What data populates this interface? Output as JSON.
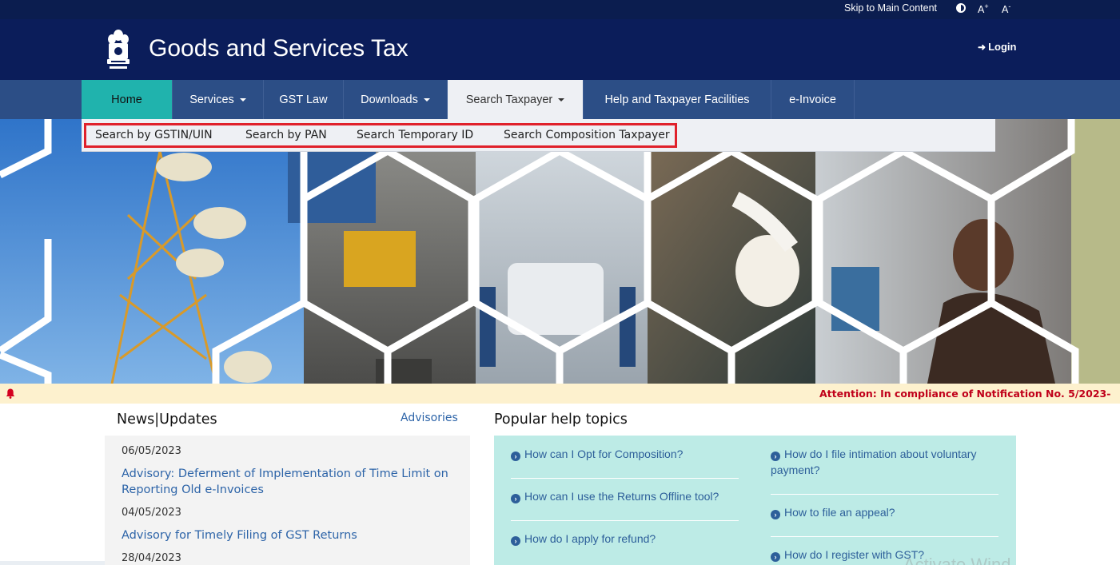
{
  "topbar": {
    "skip_label": "Skip to Main Content",
    "font_increase": "A",
    "font_increase_sup": "+",
    "font_decrease": "A",
    "font_decrease_sup": "-"
  },
  "header": {
    "title": "Goods and Services Tax",
    "login_label": "Login"
  },
  "nav": {
    "tabs": [
      {
        "label": "Home"
      },
      {
        "label": "Services"
      },
      {
        "label": "GST Law"
      },
      {
        "label": "Downloads"
      },
      {
        "label": "Search Taxpayer"
      },
      {
        "label": "Help and Taxpayer Facilities"
      },
      {
        "label": "e-Invoice"
      }
    ],
    "active_tab": "Search Taxpayer"
  },
  "submenu": {
    "items": [
      {
        "label": "Search by GSTIN/UIN"
      },
      {
        "label": "Search by PAN"
      },
      {
        "label": "Search Temporary ID"
      },
      {
        "label": "Search Composition Taxpayer"
      }
    ]
  },
  "ticker": {
    "text": "Attention: In compliance of Notification No. 5/2023-"
  },
  "news": {
    "title": "News|Updates",
    "advisories_label": "Advisories",
    "items": [
      {
        "date": "06/05/2023",
        "title": "Advisory: Deferment of Implementation of Time Limit on Reporting Old e-Invoices"
      },
      {
        "date": "04/05/2023",
        "title": "Advisory for Timely Filing of GST Returns"
      },
      {
        "date": "28/04/2023"
      }
    ]
  },
  "help": {
    "title": "Popular help topics",
    "left": [
      {
        "label": "How can I Opt for Composition?"
      },
      {
        "label": "How can I use the Returns Offline tool?"
      },
      {
        "label": "How do I apply for refund?"
      }
    ],
    "right": [
      {
        "label": "How do I file intimation about voluntary payment?"
      },
      {
        "label": "How to file an appeal?"
      },
      {
        "label": "How do I register with GST?"
      }
    ]
  },
  "watermark": "Activate Wind",
  "colors": {
    "header_bg": "#0b1d5a",
    "nav_bg": "#2c4e86",
    "home_tab": "#20b3ad",
    "link": "#2d64a8",
    "ticker_text": "#c0001a",
    "help_bg": "#bdebe6",
    "highlight_outline": "#e0212b"
  }
}
